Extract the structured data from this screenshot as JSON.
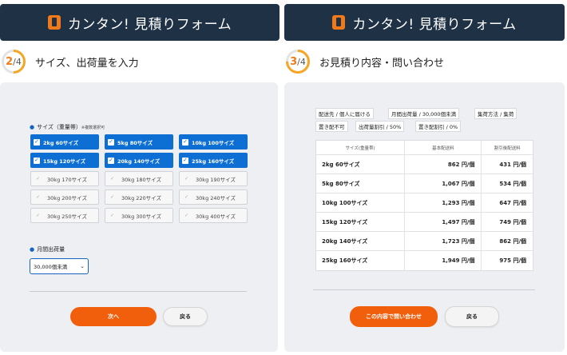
{
  "left": {
    "header_title": "カンタン! 見積りフォーム",
    "step": {
      "current": "2",
      "total": "/4",
      "title": "サイズ、出荷量を入力"
    },
    "sizes": {
      "label": "サイズ（重量帯）",
      "note": "※複数選択可",
      "options": [
        {
          "label": "2kg 60サイズ",
          "checked": true
        },
        {
          "label": "5kg 80サイズ",
          "checked": true
        },
        {
          "label": "10kg 100サイズ",
          "checked": true
        },
        {
          "label": "15kg 120サイズ",
          "checked": true
        },
        {
          "label": "20kg 140サイズ",
          "checked": true
        },
        {
          "label": "25kg 160サイズ",
          "checked": true
        },
        {
          "label": "30kg 170サイズ",
          "checked": false
        },
        {
          "label": "30kg 180サイズ",
          "checked": false
        },
        {
          "label": "30kg 190サイズ",
          "checked": false
        },
        {
          "label": "30kg 200サイズ",
          "checked": false
        },
        {
          "label": "30kg 220サイズ",
          "checked": false
        },
        {
          "label": "30kg 240サイズ",
          "checked": false
        },
        {
          "label": "30kg 250サイズ",
          "checked": false
        },
        {
          "label": "30kg 300サイズ",
          "checked": false
        },
        {
          "label": "30kg 400サイズ",
          "checked": false
        }
      ]
    },
    "volume": {
      "label": "月間出荷量",
      "value": "30,000個未満"
    },
    "next_label": "次へ",
    "back_label": "戻る"
  },
  "right": {
    "header_title": "カンタン! 見積りフォーム",
    "step": {
      "current": "3",
      "total": "/4",
      "title": "お見積り内容・問い合わせ"
    },
    "tags": [
      "配送先 / 個人に届ける",
      "月間出荷量 / 30,000個未満",
      "集荷方法 / 集荷",
      "置き配不可",
      "出荷量割引 / 50%",
      "置き配割引 / 0%"
    ],
    "table": {
      "headers": [
        "サイズ(重量帯)",
        "基本配送料",
        "割引後配送料"
      ],
      "rows": [
        [
          "2kg 60サイズ",
          "862 円/個",
          "431 円/個"
        ],
        [
          "5kg 80サイズ",
          "1,067 円/個",
          "534 円/個"
        ],
        [
          "10kg 100サイズ",
          "1,293 円/個",
          "647 円/個"
        ],
        [
          "15kg 120サイズ",
          "1,497 円/個",
          "749 円/個"
        ],
        [
          "20kg 140サイズ",
          "1,723 円/個",
          "862 円/個"
        ],
        [
          "25kg 160サイズ",
          "1,949 円/個",
          "975 円/個"
        ]
      ]
    },
    "submit_label": "この内容で問い合わせ",
    "back_label": "戻る"
  },
  "colors": {
    "header_bg": "#1f3144",
    "accent_orange": "#f25f0c",
    "selected_blue": "#0d6fd4",
    "card_bg": "#eeeff2"
  }
}
